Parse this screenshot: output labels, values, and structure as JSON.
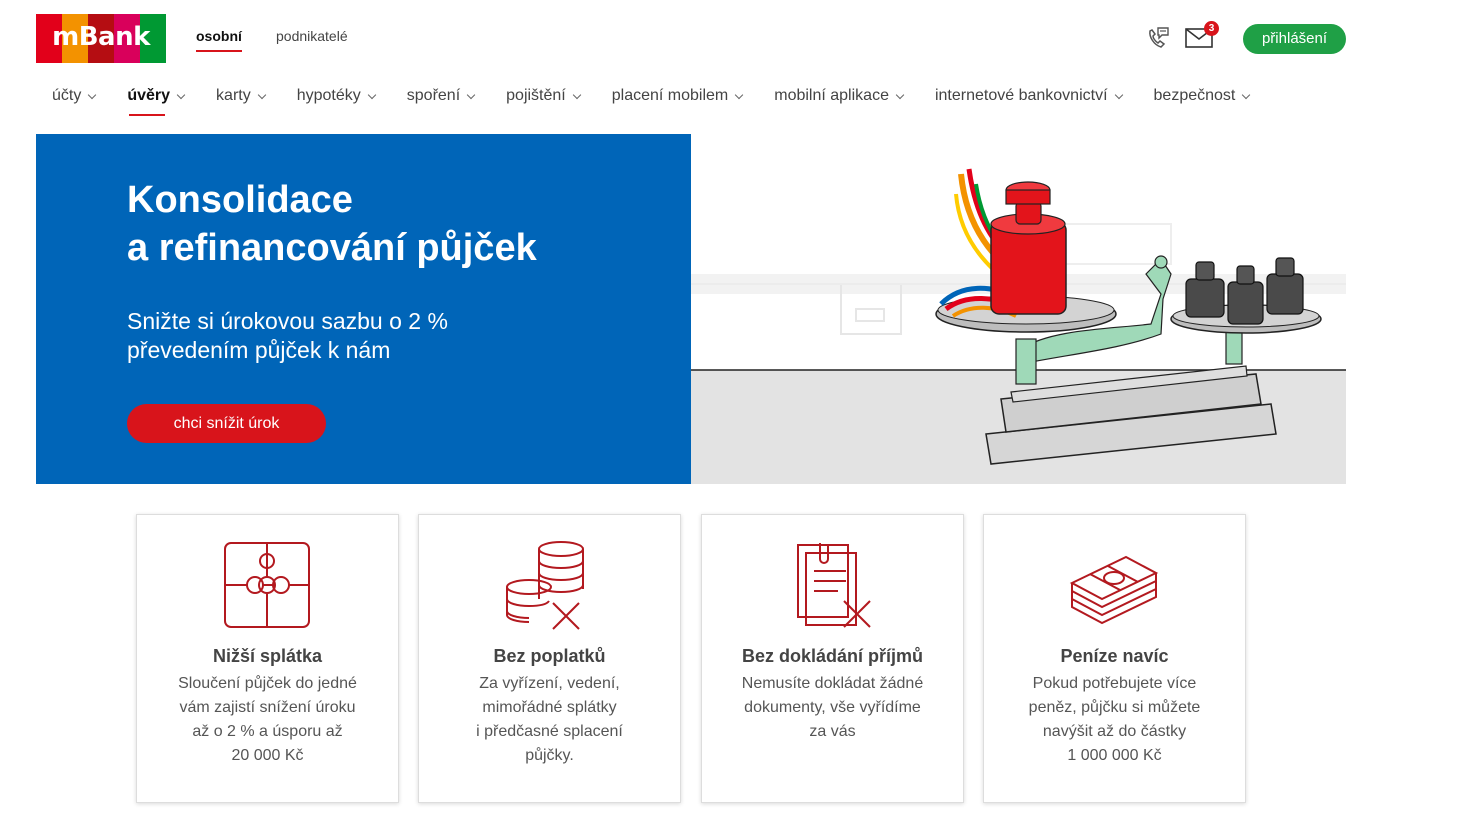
{
  "colors": {
    "brand_red": "#d8141b",
    "brand_blue": "#0065b8",
    "login_green": "#1fa046"
  },
  "header": {
    "logo_text": "mBank",
    "segments": [
      "osobní",
      "podnikatelé"
    ],
    "icons": [
      "phone-chat-icon",
      "mail-icon"
    ],
    "mail_badge": "3",
    "login_label": "přihlášení"
  },
  "nav": {
    "items": [
      "účty",
      "úvěry",
      "karty",
      "hypotéky",
      "spoření",
      "pojištění",
      "placení mobilem",
      "mobilní aplikace",
      "internetové bankovnictví",
      "bezpečnost"
    ],
    "active": "úvěry"
  },
  "hero": {
    "title_line1": "Konsolidace",
    "title_line2": "a refinancování půjček",
    "subtitle_line1": "Snižte si úrokovou sazbu o 2 %",
    "subtitle_line2": "převedením půjček k nám",
    "cta_label": "chci snížit úrok"
  },
  "features": [
    {
      "icon": "puzzle-icon",
      "title": "Nižší splátka",
      "lines": [
        "Sloučení půjček do jedné",
        "vám zajistí snížení úroku",
        "až o 2 % a úsporu až",
        "20 000 Kč"
      ]
    },
    {
      "icon": "coins-cross-icon",
      "title": "Bez poplatků",
      "lines": [
        "Za vyřízení, vedení,",
        "mimořádné splátky",
        "i předčasné splacení",
        "půjčky."
      ]
    },
    {
      "icon": "documents-cross-icon",
      "title": "Bez dokládání příjmů",
      "lines": [
        "Nemusíte dokládat žádné",
        "dokumenty, vše vyřídíme",
        "za vás"
      ]
    },
    {
      "icon": "money-stack-icon",
      "title": "Peníze navíc",
      "lines": [
        "Pokud potřebujete více",
        "peněz, půjčku si můžete",
        "navýšit až do částky",
        "1 000 000 Kč"
      ]
    }
  ]
}
